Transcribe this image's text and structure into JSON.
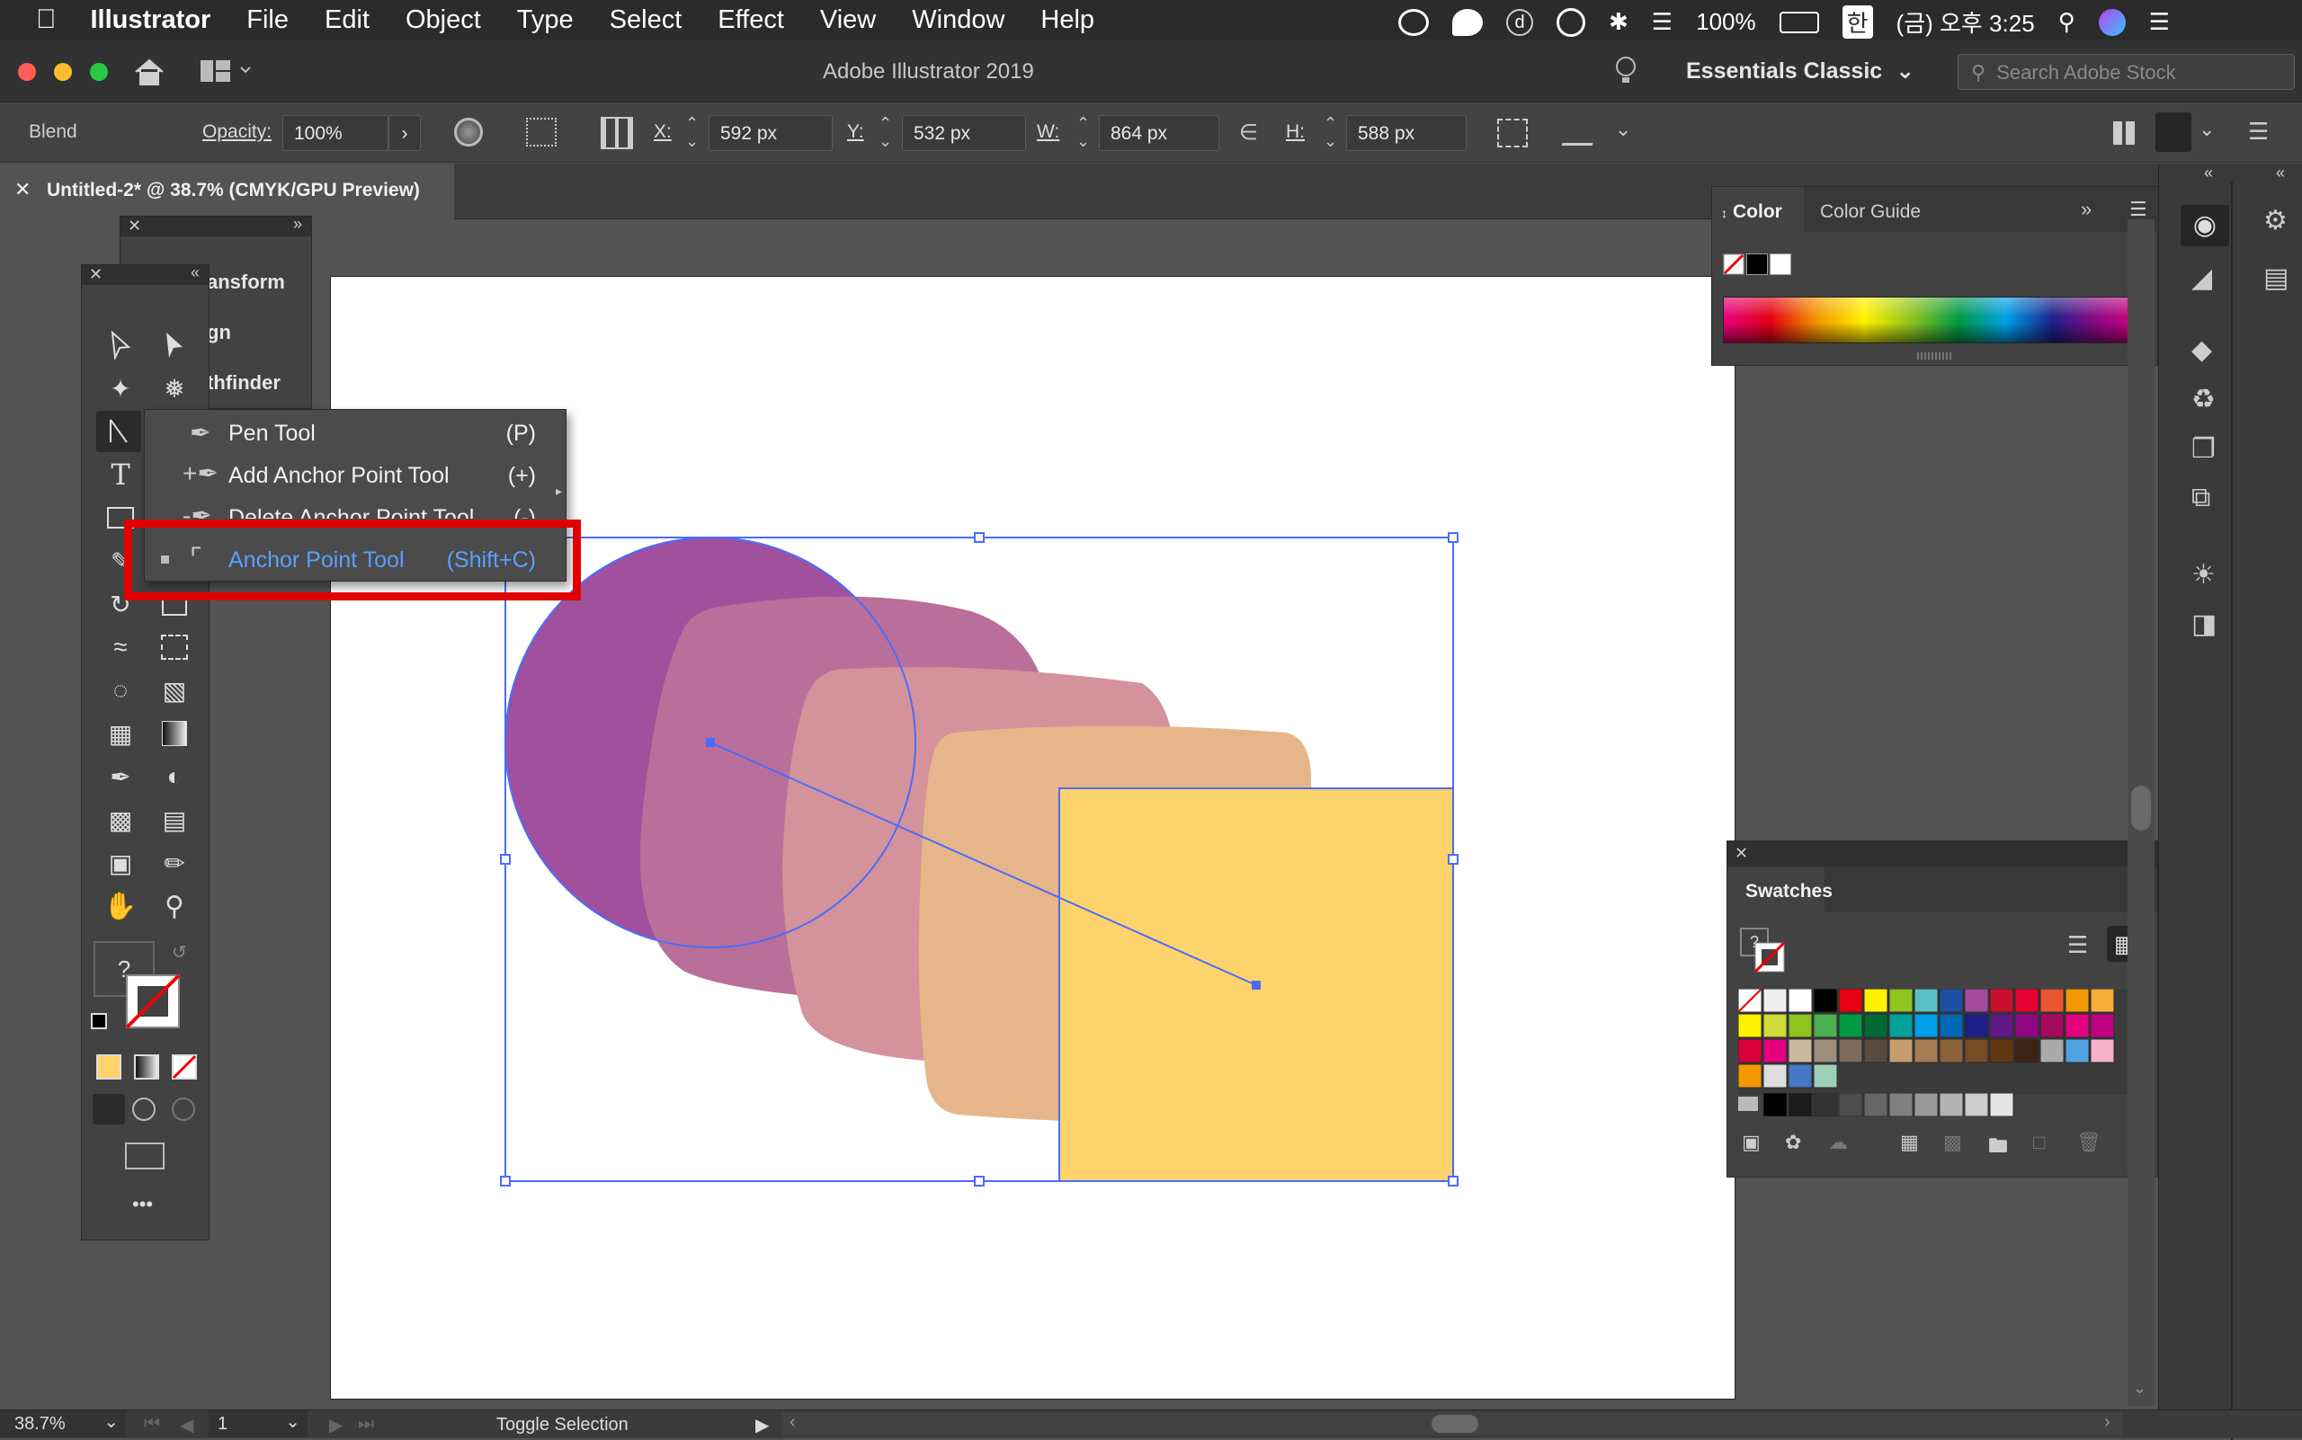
{
  "menubar": {
    "app": "Illustrator",
    "items": [
      "File",
      "Edit",
      "Object",
      "Type",
      "Select",
      "Effect",
      "View",
      "Window",
      "Help"
    ],
    "battery": "100%",
    "input_lang": "한",
    "clock": "(금) 오후 3:25"
  },
  "titlebar": {
    "title": "Adobe Illustrator 2019",
    "workspace": "Essentials Classic",
    "search_placeholder": "Search Adobe Stock"
  },
  "control": {
    "mode": "Blend",
    "opacity_label": "Opacity:",
    "opacity": "100%",
    "x_label": "X:",
    "x": "592 px",
    "y_label": "Y:",
    "y": "532 px",
    "w_label": "W:",
    "w": "864 px",
    "h_label": "H:",
    "h": "588 px"
  },
  "document": {
    "tab": "Untitled-2* @ 38.7% (CMYK/GPU Preview)"
  },
  "behind_panel": {
    "items": [
      "ansform",
      "gn",
      "thfinder"
    ]
  },
  "flyout": {
    "items": [
      {
        "name": "Pen Tool",
        "shortcut": "(P)"
      },
      {
        "name": "Add Anchor Point Tool",
        "shortcut": "(+)"
      },
      {
        "name": "Delete Anchor Point Tool",
        "shortcut": "(-)"
      },
      {
        "name": "Anchor Point Tool",
        "shortcut": "(Shift+C)"
      }
    ]
  },
  "color_panel": {
    "tabs": [
      "Color",
      "Color Guide"
    ]
  },
  "swatches_panel": {
    "title": "Swatches"
  },
  "toolbar": {
    "unknown_fill": "?",
    "more": "•••"
  },
  "status": {
    "zoom": "38.7%",
    "page": "1",
    "info": "Toggle Selection"
  },
  "colors": {
    "purple": "#a0509c",
    "mauve": "#b96f9a",
    "pink": "#d4929a",
    "peach": "#e6b68a",
    "yellow": "#ffd36c",
    "selection": "#4a6cff",
    "highlight": "#e00000"
  },
  "icons": [
    "apple-icon",
    "home-icon",
    "lightbulb-icon",
    "search-icon",
    "pen-icon",
    "anchor-point-icon",
    "hamburger-icon"
  ]
}
